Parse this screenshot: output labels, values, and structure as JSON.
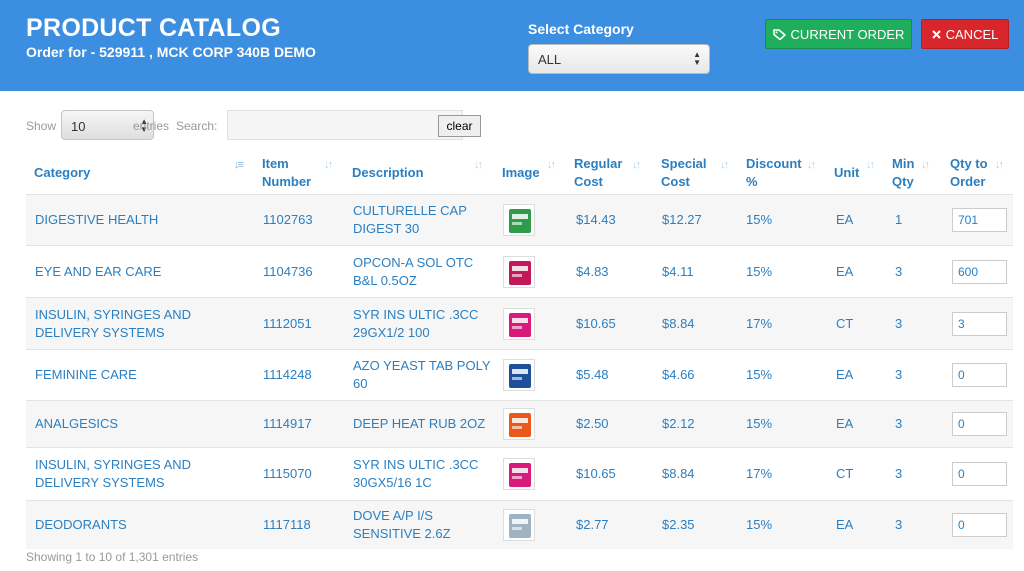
{
  "header": {
    "title": "PRODUCT CATALOG",
    "subtitle": "Order for - 529911 , MCK CORP 340B DEMO",
    "category_label": "Select Category",
    "category_value": "ALL",
    "current_order_label": "CURRENT ORDER",
    "cancel_label": "CANCEL"
  },
  "controls": {
    "show_label": "Show",
    "page_length": "10",
    "entries_label": "entries",
    "search_label": "Search:",
    "search_value": "",
    "clear_label": "clear"
  },
  "columns": [
    "Category",
    "Item Number",
    "Description",
    "Image",
    "Regular Cost",
    "Special Cost",
    "Discount %",
    "Unit",
    "Min Qty",
    "Qty to Order"
  ],
  "rows": [
    {
      "category": "DIGESTIVE HEALTH",
      "item": "1102763",
      "description": "CULTURELLE CAP DIGEST 30",
      "regular": "$14.43",
      "special": "$12.27",
      "discount": "15%",
      "unit": "EA",
      "min": "1",
      "qty": "701",
      "image_color": "#2e9d4b"
    },
    {
      "category": "EYE AND EAR CARE",
      "item": "1104736",
      "description": "OPCON-A SOL OTC B&L 0.5OZ",
      "regular": "$4.83",
      "special": "$4.11",
      "discount": "15%",
      "unit": "EA",
      "min": "3",
      "qty": "600",
      "image_color": "#c2185b"
    },
    {
      "category": "INSULIN, SYRINGES AND DELIVERY SYSTEMS",
      "item": "1112051",
      "description": "SYR INS ULTIC .3CC 29GX1/2 100",
      "regular": "$10.65",
      "special": "$8.84",
      "discount": "17%",
      "unit": "CT",
      "min": "3",
      "qty": "3",
      "image_color": "#d81b7a"
    },
    {
      "category": "FEMININE CARE",
      "item": "1114248",
      "description": "AZO YEAST TAB POLY 60",
      "regular": "$5.48",
      "special": "$4.66",
      "discount": "15%",
      "unit": "EA",
      "min": "3",
      "qty": "0",
      "image_color": "#1e4f9c"
    },
    {
      "category": "ANALGESICS",
      "item": "1114917",
      "description": "DEEP HEAT RUB 2OZ",
      "regular": "$2.50",
      "special": "$2.12",
      "discount": "15%",
      "unit": "EA",
      "min": "3",
      "qty": "0",
      "image_color": "#e85a1b"
    },
    {
      "category": "INSULIN, SYRINGES AND DELIVERY SYSTEMS",
      "item": "1115070",
      "description": "SYR INS ULTIC .3CC 30GX5/16 1C",
      "regular": "$10.65",
      "special": "$8.84",
      "discount": "17%",
      "unit": "CT",
      "min": "3",
      "qty": "0",
      "image_color": "#d81b7a"
    },
    {
      "category": "DEODORANTS",
      "item": "1117118",
      "description": "DOVE A/P I/S SENSITIVE 2.6Z",
      "regular": "$2.77",
      "special": "$2.35",
      "discount": "15%",
      "unit": "EA",
      "min": "3",
      "qty": "0",
      "image_color": "#9fb3c2"
    }
  ],
  "footer": {
    "info": "Showing 1 to 10 of 1,301 entries"
  },
  "colors": {
    "header_bg": "#3c8ee0",
    "accent_text": "#2b7fc1",
    "order_button": "#1fae5b",
    "cancel_button": "#d8262d"
  },
  "icons": {
    "order_button_icon": "tag-icon",
    "cancel_button_icon": "close-icon",
    "select_icon": "select-arrows-icon",
    "sort_icon": "sort-arrows-icon"
  }
}
